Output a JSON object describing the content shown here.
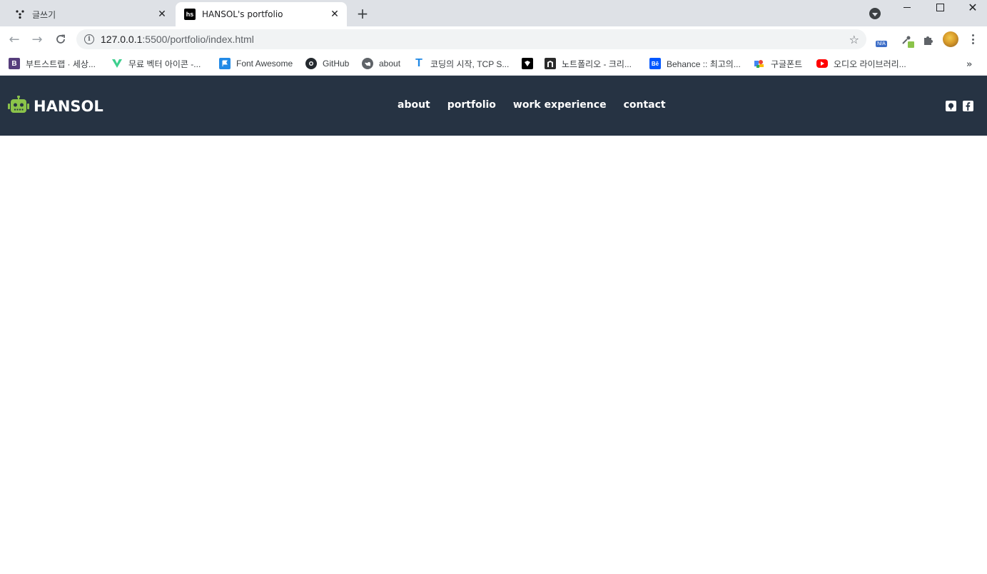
{
  "browser": {
    "tabs": [
      {
        "title": "글쓰기",
        "active": false
      },
      {
        "title": "HANSOL's portfolio",
        "active": true
      }
    ],
    "url_host": "127.0.0.1",
    "url_path": ":5500/portfolio/index.html",
    "extension_badge": "N/A",
    "favicon_text": "hs",
    "bookmarks": [
      {
        "label": "부트스트랩 · 세상...",
        "icon": "bootstrap-icon",
        "color": "#563d7c",
        "glyph": "B"
      },
      {
        "label": "무료 벡터 아이콘 -...",
        "icon": "vector-icon",
        "color": "#3ecf8e",
        "glyph": ""
      },
      {
        "label": "Font Awesome",
        "icon": "font-awesome-icon",
        "color": "#228ae6",
        "glyph": ""
      },
      {
        "label": "GitHub",
        "icon": "github-icon",
        "color": "#24292e",
        "glyph": ""
      },
      {
        "label": "about",
        "icon": "globe-icon",
        "color": "#5f6368",
        "glyph": ""
      },
      {
        "label": "코딩의 시작, TCP S...",
        "icon": "tcp-icon",
        "color": "#1e88e5",
        "glyph": "T"
      },
      {
        "label": "",
        "icon": "dark-bookmark-icon",
        "color": "#000000",
        "glyph": ""
      },
      {
        "label": "노트폴리오 - 크리...",
        "icon": "notefolio-icon",
        "color": "#2b2b2b",
        "glyph": "n"
      },
      {
        "label": "Behance :: 최고의...",
        "icon": "behance-icon",
        "color": "#0057ff",
        "glyph": "Bē"
      },
      {
        "label": "구글폰트",
        "icon": "google-fonts-icon",
        "color": "#fbbc04",
        "glyph": ""
      },
      {
        "label": "오디오 라이브러리...",
        "icon": "youtube-icon",
        "color": "#ff0000",
        "glyph": ""
      }
    ]
  },
  "header": {
    "logo_text": "HANSOL",
    "menu": [
      "about",
      "portfolio",
      "work experience",
      "contact"
    ],
    "bg_color": "#263343",
    "logo_color": "#8bc34a"
  }
}
